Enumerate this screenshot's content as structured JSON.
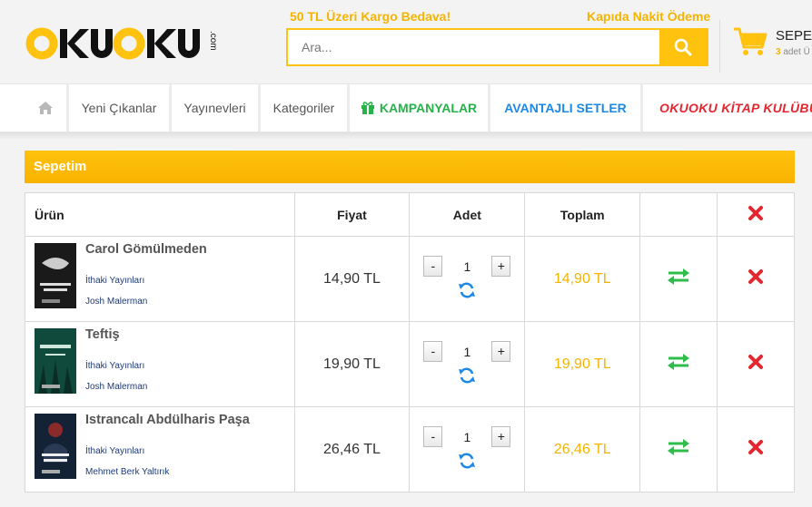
{
  "header": {
    "logo_text": "okuoku.com",
    "promo_left": "50 TL Üzeri Kargo Bedava!",
    "promo_right": "Kapıda Nakit Ödeme",
    "search_placeholder": "Ara...",
    "cart": {
      "title": "SEPE",
      "count": "3",
      "count_suffix": "adet Ü"
    }
  },
  "nav": {
    "items": [
      "Yeni Çıkanlar",
      "Yayınevleri",
      "Kategoriler",
      "KAMPANYALAR",
      "AVANTAJLI SETLER",
      "OKUOKU KİTAP KULÜBÜ"
    ]
  },
  "cart_section": {
    "title": "Sepetim",
    "columns": {
      "product": "Ürün",
      "price": "Fiyat",
      "qty": "Adet",
      "total": "Toplam"
    },
    "items": [
      {
        "title": "Carol Gömülmeden",
        "publisher": "İthaki Yayınları",
        "author": "Josh Malerman",
        "price": "14,90 TL",
        "qty": "1",
        "total": "14,90 TL",
        "cover_color": "#1a1a1a"
      },
      {
        "title": "Teftiş",
        "publisher": "İthaki Yayınları",
        "author": "Josh Malerman",
        "price": "19,90 TL",
        "qty": "1",
        "total": "19,90 TL",
        "cover_color": "#0f4a3c"
      },
      {
        "title": "Istrancalı Abdülharis Paşa",
        "publisher": "İthaki Yayınları",
        "author": "Mehmet Berk Yaltırık",
        "price": "26,46 TL",
        "qty": "1",
        "total": "26,46 TL",
        "cover_color": "#142236"
      }
    ]
  },
  "colors": {
    "brand_yellow": "#ffc20e",
    "transfer_green": "#2ebd4a",
    "delete_red": "#e3262f",
    "refresh_blue": "#1e88e5"
  }
}
